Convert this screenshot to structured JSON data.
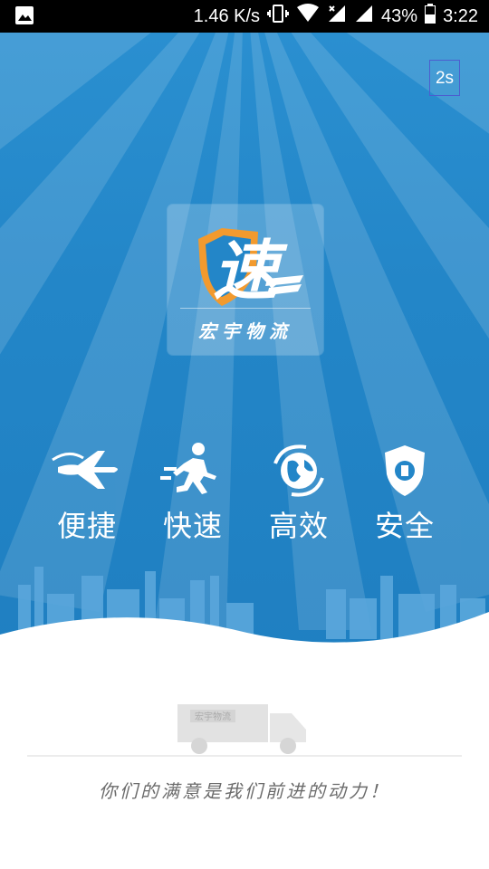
{
  "status_bar": {
    "image_icon": "image-icon",
    "net_speed": "1.46 K/s",
    "battery_percent": "43%",
    "time": "3:22"
  },
  "splash": {
    "skip_countdown": "2s",
    "logo_mark_text": "速",
    "logo_caption": "宏宇物流",
    "features": [
      {
        "icon": "airplane-icon",
        "label": "便捷"
      },
      {
        "icon": "running-courier-icon",
        "label": "快速"
      },
      {
        "icon": "globe-icon",
        "label": "高效"
      },
      {
        "icon": "shield-icon",
        "label": "安全"
      }
    ],
    "truck_sign": "宏宇物流",
    "slogan": "你们的满意是我们前进的动力！"
  }
}
